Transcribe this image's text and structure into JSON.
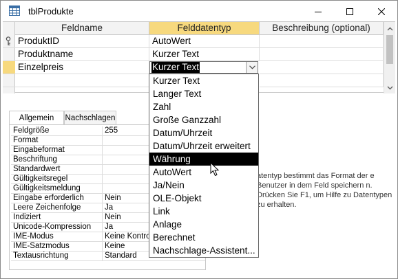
{
  "window": {
    "title": "tblProdukte"
  },
  "grid": {
    "headers": {
      "field_name": "Feldname",
      "data_type": "Felddatentyp",
      "description": "Beschreibung (optional)"
    },
    "rows": [
      {
        "name": "ProduktID",
        "type": "AutoWert",
        "description": "",
        "primary_key": true
      },
      {
        "name": "Produktname",
        "type": "Kurzer Text",
        "description": ""
      },
      {
        "name": "Einzelpreis",
        "type": "Kurzer Text",
        "description": "",
        "current": true
      }
    ]
  },
  "dropdown": {
    "options": [
      "Kurzer Text",
      "Langer Text",
      "Zahl",
      "Große Ganzzahl",
      "Datum/Uhrzeit",
      "Datum/Uhrzeit erweitert",
      "Währung",
      "AutoWert",
      "Ja/Nein",
      "OLE-Objekt",
      "Link",
      "Anlage",
      "Berechnet",
      "Nachschlage-Assistent..."
    ],
    "highlighted": "Währung"
  },
  "properties": {
    "tabs": [
      "Allgemein",
      "Nachschlagen"
    ],
    "active_tab": "Allgemein",
    "rows": [
      {
        "name": "Feldgröße",
        "value": "255"
      },
      {
        "name": "Format",
        "value": ""
      },
      {
        "name": "Eingabeformat",
        "value": ""
      },
      {
        "name": "Beschriftung",
        "value": ""
      },
      {
        "name": "Standardwert",
        "value": ""
      },
      {
        "name": "Gültigkeitsregel",
        "value": ""
      },
      {
        "name": "Gültigkeitsmeldung",
        "value": ""
      },
      {
        "name": "Eingabe erforderlich",
        "value": "Nein"
      },
      {
        "name": "Leere Zeichenfolge",
        "value": "Ja"
      },
      {
        "name": "Indiziert",
        "value": "Nein"
      },
      {
        "name": "Unicode-Kompression",
        "value": "Ja"
      },
      {
        "name": "IME-Modus",
        "value": "Keine Kontro"
      },
      {
        "name": "IME-Satzmodus",
        "value": "Keine"
      },
      {
        "name": "Textausrichtung",
        "value": "Standard"
      }
    ]
  },
  "help_text": "atentyp bestimmt das Format der e Benutzer in dem Feld speichern n. Drücken Sie F1, um Hilfe zu Datentypen zu erhalten.",
  "colors": {
    "selection": "#f7d97e",
    "highlight": "#000000"
  }
}
